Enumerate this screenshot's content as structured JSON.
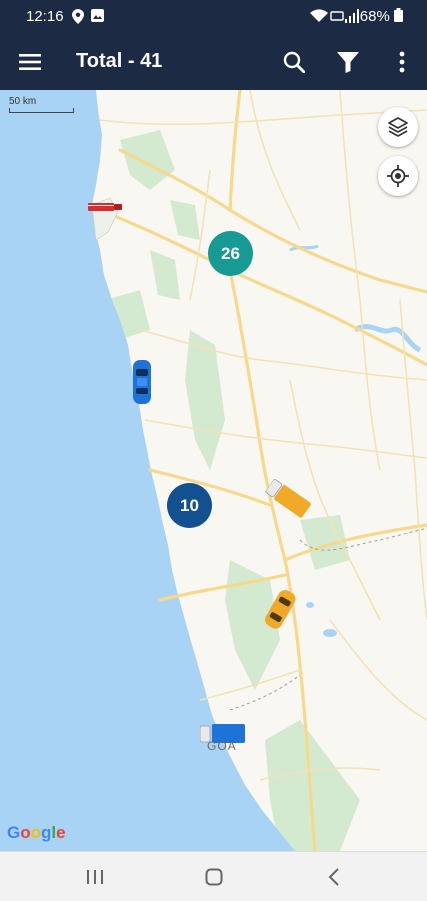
{
  "status_bar": {
    "time": "12:16",
    "battery": "68%"
  },
  "app_bar": {
    "title": "Total - 41",
    "menu_icon": "hamburger-menu-icon",
    "search_icon": "search-icon",
    "filter_icon": "filter-icon",
    "more_icon": "more-vert-icon"
  },
  "map": {
    "scale_label": "50 km",
    "place_label": "GOA",
    "layers_icon": "layers-icon",
    "locate_icon": "my-location-icon",
    "attribution": "Google",
    "clusters": [
      {
        "count": "26",
        "color": "#179a94"
      },
      {
        "count": "10",
        "color": "#13508f"
      }
    ],
    "vehicles": [
      {
        "type": "truck",
        "color": "#d32f2f"
      },
      {
        "type": "car",
        "color": "#1e73d8"
      },
      {
        "type": "truck",
        "color": "#f1a92a"
      },
      {
        "type": "car",
        "color": "#f1a92a"
      },
      {
        "type": "truck",
        "color": "#1e73d8"
      }
    ],
    "colors": {
      "sea": "#a9d3f4",
      "land": "#f8f7f2",
      "roads": "#f6d98c",
      "forest": "#cfe6c7"
    }
  },
  "nav_bar": {
    "recents_icon": "recents-icon",
    "home_icon": "home-icon",
    "back_icon": "back-icon"
  }
}
